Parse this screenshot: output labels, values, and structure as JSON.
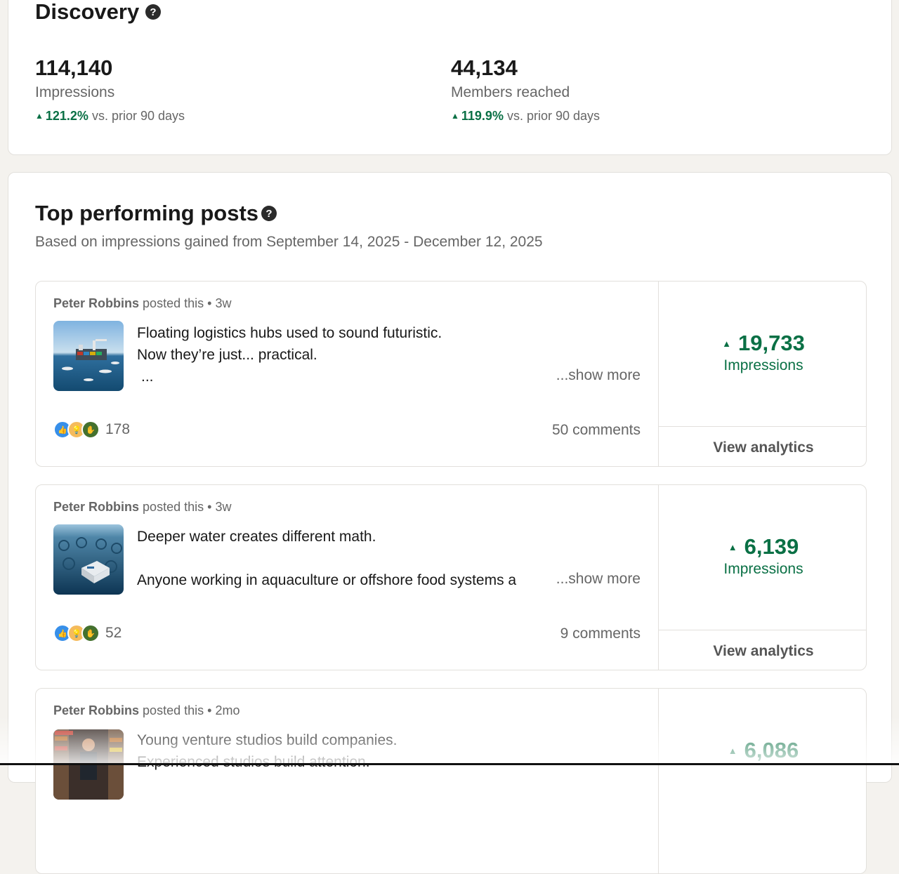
{
  "discovery": {
    "title": "Discovery",
    "help_glyph": "?",
    "metrics": [
      {
        "value": "114,140",
        "label": "Impressions",
        "change": "121.2%",
        "change_suffix": "vs. prior 90 days"
      },
      {
        "value": "44,134",
        "label": "Members reached",
        "change": "119.9%",
        "change_suffix": "vs. prior 90 days"
      }
    ]
  },
  "top_posts": {
    "title": "Top performing posts",
    "help_glyph": "?",
    "subtitle": "Based on impressions gained from September 14, 2025 - December 12, 2025",
    "posts": [
      {
        "author": "Peter Robbins",
        "posted": "posted this",
        "separator": "•",
        "age": "3w",
        "lines": [
          "Floating logistics hubs used to sound futuristic.",
          "Now they’re just... practical.",
          "..."
        ],
        "show_more": "...show more",
        "reaction_count": "178",
        "comments": "50 comments",
        "impressions": "19,733",
        "impressions_label": "Impressions",
        "action": "View analytics"
      },
      {
        "author": "Peter Robbins",
        "posted": "posted this",
        "separator": "•",
        "age": "3w",
        "lines": [
          "Deeper water creates different math.",
          "",
          "Anyone working in aquaculture or offshore food systems a"
        ],
        "show_more": "...show more",
        "reaction_count": "52",
        "comments": "9 comments",
        "impressions": "6,139",
        "impressions_label": "Impressions",
        "action": "View analytics"
      },
      {
        "author": "Peter Robbins",
        "posted": "posted this",
        "separator": "•",
        "age": "2mo",
        "lines": [
          "Young venture studios build companies.",
          "Experienced studios build attention."
        ],
        "impressions": "6,086"
      }
    ]
  },
  "icons": {
    "trend_up": "▲",
    "reactions": [
      "like-icon",
      "insightful-icon",
      "support-icon"
    ]
  },
  "colors": {
    "page_bg": "#f4f2ee",
    "positive": "#0a7045",
    "muted_text": "#666666",
    "card_border": "#e2e0dc"
  }
}
